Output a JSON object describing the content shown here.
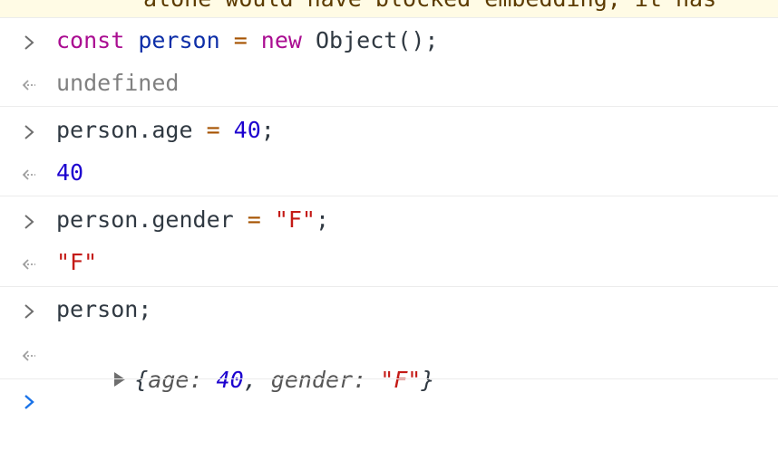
{
  "top_warning": "alone would have blocked embedding, it has",
  "entries": [
    {
      "input_tokens": [
        {
          "t": "const",
          "c": "k-keyword"
        },
        {
          "t": " ",
          "c": "k-plain"
        },
        {
          "t": "person",
          "c": "k-var"
        },
        {
          "t": " = ",
          "c": "k-op"
        },
        {
          "t": "new",
          "c": "k-keyword"
        },
        {
          "t": " Object();",
          "c": "k-plain"
        }
      ],
      "result_tokens": [
        {
          "t": "undefined",
          "c": "k-undef"
        }
      ]
    },
    {
      "input_tokens": [
        {
          "t": "person.age",
          "c": "k-plain"
        },
        {
          "t": " = ",
          "c": "k-op"
        },
        {
          "t": "40",
          "c": "k-num"
        },
        {
          "t": ";",
          "c": "k-plain"
        }
      ],
      "result_tokens": [
        {
          "t": "40",
          "c": "k-num"
        }
      ]
    },
    {
      "input_tokens": [
        {
          "t": "person.gender",
          "c": "k-plain"
        },
        {
          "t": " = ",
          "c": "k-op"
        },
        {
          "t": "\"F\"",
          "c": "k-str"
        },
        {
          "t": ";",
          "c": "k-plain"
        }
      ],
      "result_tokens": [
        {
          "t": "\"F\"",
          "c": "k-str"
        }
      ]
    },
    {
      "input_tokens": [
        {
          "t": "person;",
          "c": "k-plain"
        }
      ],
      "result_object": {
        "open": "{",
        "props": [
          {
            "key": "age",
            "sep": ": ",
            "value": "40",
            "value_class": "k-num"
          },
          {
            "key": "gender",
            "sep": ": ",
            "value": "\"F\"",
            "value_class": "k-str"
          }
        ],
        "delim": ", ",
        "close": "}"
      }
    }
  ],
  "colors": {
    "prompt_icon": "#6e6e6e",
    "result_icon": "#a0a0a0",
    "active_prompt_icon": "#1a73e8",
    "warning_background": "#fffbe5"
  },
  "icons": {
    "prompt": "chevron-right-icon",
    "result": "return-arrow-icon",
    "expand": "expand-triangle-icon"
  }
}
